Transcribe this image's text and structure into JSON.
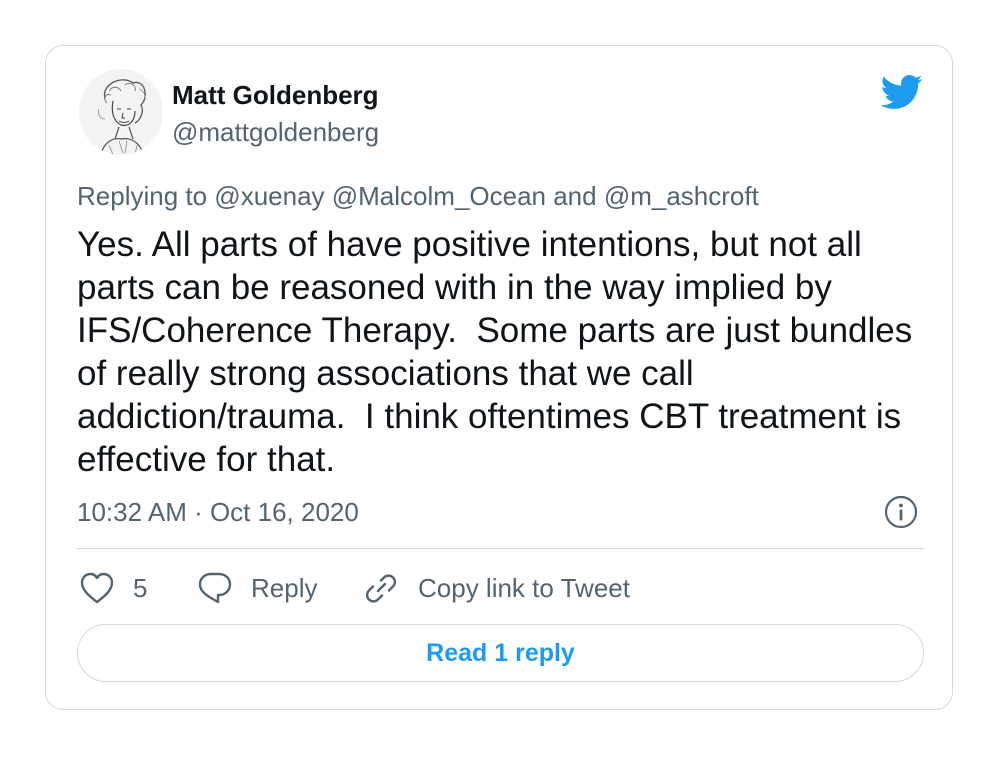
{
  "colors": {
    "brand": "#1d9bf0",
    "text_primary": "#0f1419",
    "text_secondary": "#536471",
    "border": "#cfd9de"
  },
  "author": {
    "name": "Matt Goldenberg",
    "handle": "@mattgoldenberg",
    "avatar_icon": "sketch-portrait-avatar"
  },
  "logo_icon": "twitter-bird-icon",
  "replying_to": "Replying to @xuenay @Malcolm_Ocean and @m_ashcroft",
  "tweet_text": "Yes. All parts of have positive intentions, but not all parts can be reasoned with in the way implied by IFS/Coherence Therapy.  Some parts are just bundles of really strong associations that we call addiction/trauma.  I think oftentimes CBT treatment is effective for that.",
  "timestamp": "10:32 AM · Oct 16, 2020",
  "actions": {
    "like_count": "5",
    "reply_label": "Reply",
    "copy_label": "Copy link to Tweet"
  },
  "read_replies_label": "Read 1 reply"
}
